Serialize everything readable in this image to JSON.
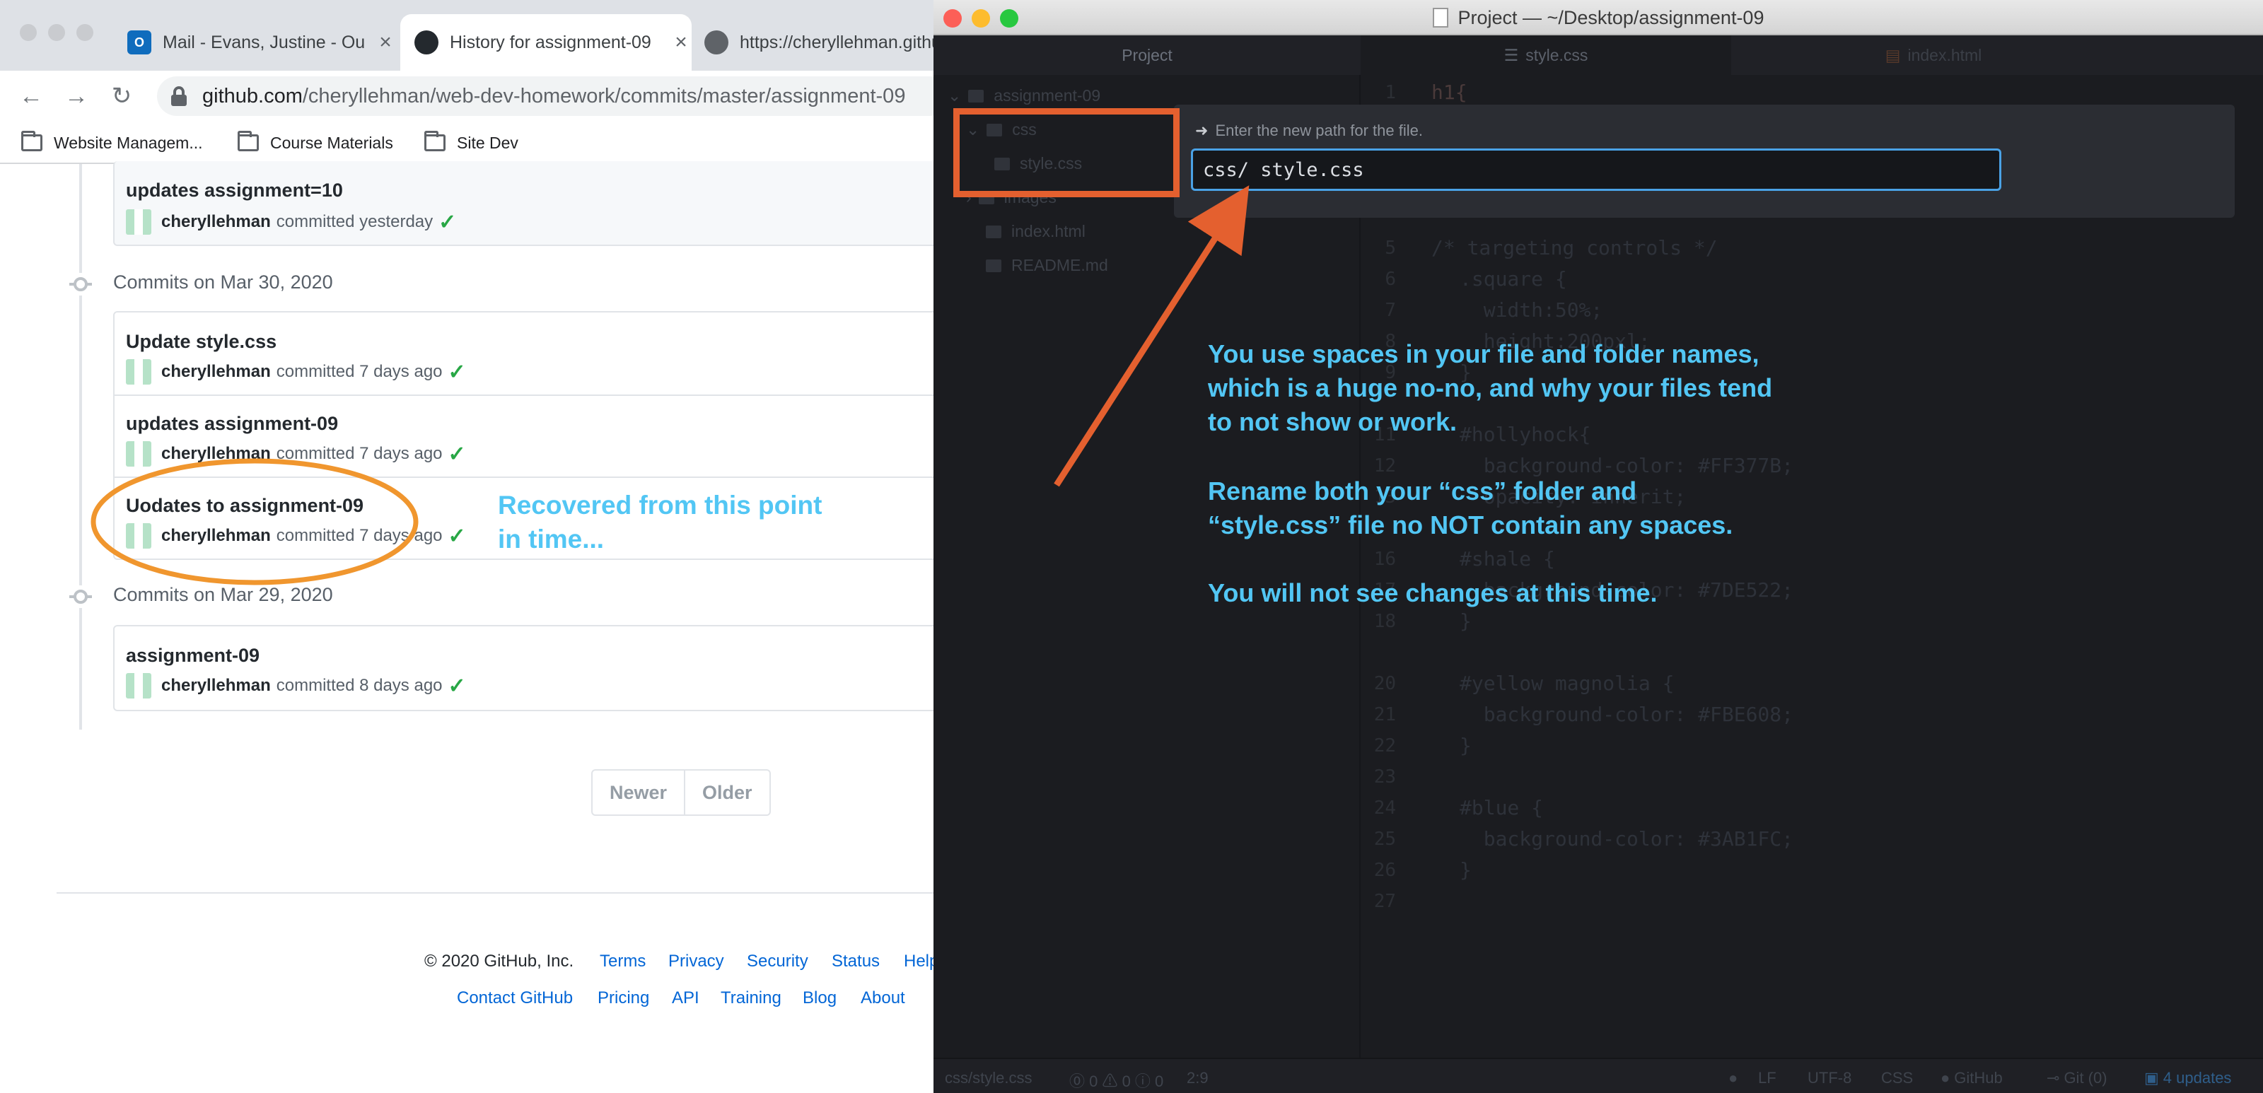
{
  "chrome": {
    "tabs": [
      {
        "title": "Mail - Evans, Justine - Ou",
        "icon": "outlook-icon",
        "color": "#0f6cbd"
      },
      {
        "title": "History for assignment-09",
        "icon": "github-icon",
        "color": "#24292e"
      },
      {
        "title": "https://cheryllehman.githu",
        "icon": "globe-icon",
        "color": "#5f6368"
      }
    ],
    "url_host": "github.com",
    "url_path": "/cheryllehman/web-dev-homework/commits/master/assignment-09",
    "bookmarks": [
      "Website Managem...",
      "Course Materials",
      "Site Dev"
    ]
  },
  "github": {
    "top_commit": {
      "title": "updates assignment=10",
      "author": "cheryllehman",
      "time": "committed yesterday"
    },
    "groups": [
      {
        "date": "Commits on Mar 30, 2020",
        "commits": [
          {
            "title": "Update style.css",
            "author": "cheryllehman",
            "time": "committed 7 days ago"
          },
          {
            "title": "updates assignment-09",
            "author": "cheryllehman",
            "time": "committed 7 days ago"
          },
          {
            "title": "Uodates to assignment-09",
            "author": "cheryllehman",
            "time": "committed 7 days ago"
          }
        ]
      },
      {
        "date": "Commits on Mar 29, 2020",
        "commits": [
          {
            "title": "assignment-09",
            "author": "cheryllehman",
            "time": "committed 8 days ago"
          }
        ]
      }
    ],
    "pagination": {
      "newer": "Newer",
      "older": "Older"
    },
    "footer": {
      "copyright": "© 2020 GitHub, Inc.",
      "row1": [
        "Terms",
        "Privacy",
        "Security",
        "Status",
        "Help"
      ],
      "row2": [
        "Contact GitHub",
        "Pricing",
        "API",
        "Training",
        "Blog",
        "About"
      ]
    }
  },
  "annotations": {
    "left_note": [
      "Recovered from this point",
      "in time..."
    ],
    "right_note": [
      "You use spaces in your file and folder names,",
      "which is a huge no-no, and why your files tend",
      "to not show or work.",
      "",
      "Rename both your “css” folder and",
      "“style.css” file no NOT contain any spaces.",
      "",
      "You will not see changes at this time."
    ],
    "colors": {
      "note_text": "#52c6f4",
      "circle": "#f0962e",
      "arrow": "#e4602f"
    }
  },
  "atom": {
    "window_title": "Project — ~/Desktop/assignment-09",
    "tree_header": "Project",
    "tabs": [
      "style.css",
      "index.html"
    ],
    "tree": [
      {
        "name": "assignment-09",
        "kind": "folder"
      },
      {
        "name": "css",
        "kind": "folder"
      },
      {
        "name": "style.css",
        "kind": "file"
      },
      {
        "name": "images",
        "kind": "folder"
      },
      {
        "name": "index.html",
        "kind": "file"
      },
      {
        "name": "README.md",
        "kind": "file"
      }
    ],
    "dialog": {
      "message": "Enter the new path for the file.",
      "value": "css/ style.css"
    },
    "code_lines": [
      {
        "n": "1",
        "text": "h1{"
      },
      {
        "n": "5",
        "text": "/* targeting controls */"
      },
      {
        "n": "6",
        "text": ".square {"
      },
      {
        "n": "7",
        "text": "  width:50%;"
      },
      {
        "n": "8",
        "text": "  height:200pxl;"
      },
      {
        "n": "9",
        "text": "}"
      },
      {
        "n": "11",
        "text": "#hollyhock{"
      },
      {
        "n": "12",
        "text": "  background-color: #FF377B;"
      },
      {
        "n": "13",
        "text": "  opacity: inherit;"
      },
      {
        "n": "16",
        "text": "#shale {"
      },
      {
        "n": "17",
        "text": "  background-color: #7DE522;"
      },
      {
        "n": "18",
        "text": "}"
      },
      {
        "n": "20",
        "text": "#yellow magnolia {"
      },
      {
        "n": "21",
        "text": "  background-color: #FBE608;"
      },
      {
        "n": "22",
        "text": "}"
      },
      {
        "n": "23",
        "text": ""
      },
      {
        "n": "24",
        "text": "#blue {"
      },
      {
        "n": "25",
        "text": "  background-color: #3AB1FC;"
      },
      {
        "n": "26",
        "text": "}"
      },
      {
        "n": "27",
        "text": ""
      }
    ],
    "status": {
      "file": "css/style.css",
      "problems": "⓪ 0 ⚠ 0 ⓘ 0",
      "cursor": "2:9",
      "line_ending": "LF",
      "encoding": "UTF-8",
      "grammar": "CSS",
      "github": "GitHub",
      "git": "Git (0)",
      "updates": "4 updates"
    }
  }
}
